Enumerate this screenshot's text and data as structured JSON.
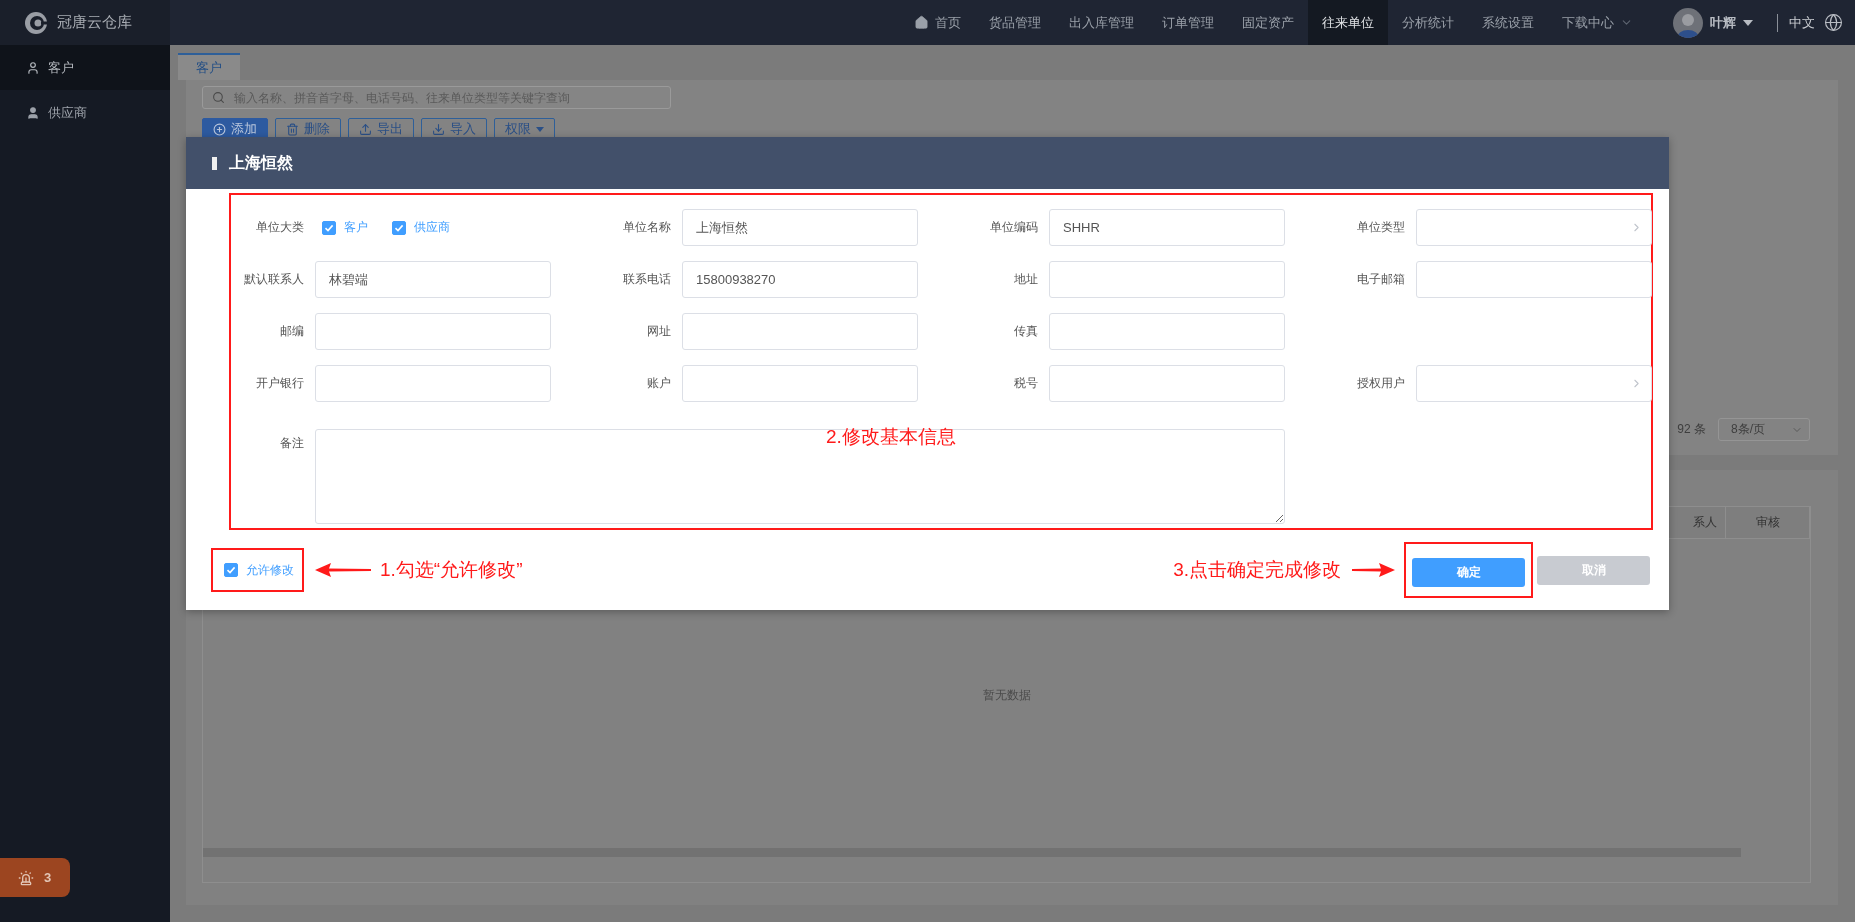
{
  "app": {
    "name": "冠唐云仓库"
  },
  "nav": [
    {
      "label": "首页",
      "has_icon": true,
      "has_menu": false,
      "selected": false
    },
    {
      "label": "货品管理",
      "has_icon": false,
      "has_menu": false,
      "selected": false
    },
    {
      "label": "出入库管理",
      "has_icon": false,
      "has_menu": false,
      "selected": false
    },
    {
      "label": "订单管理",
      "has_icon": false,
      "has_menu": false,
      "selected": false
    },
    {
      "label": "固定资产",
      "has_icon": false,
      "has_menu": false,
      "selected": false
    },
    {
      "label": "往来单位",
      "has_icon": false,
      "has_menu": false,
      "selected": true
    },
    {
      "label": "分析统计",
      "has_icon": false,
      "has_menu": false,
      "selected": false
    },
    {
      "label": "系统设置",
      "has_icon": false,
      "has_menu": false,
      "selected": false
    },
    {
      "label": "下载中心",
      "has_icon": false,
      "has_menu": true,
      "selected": false
    }
  ],
  "user": {
    "name": "叶辉"
  },
  "language": "中文",
  "sidebar": {
    "items": [
      {
        "label": "客户",
        "selected": true
      },
      {
        "label": "供应商",
        "selected": false
      }
    ]
  },
  "alarm": {
    "count": "3"
  },
  "tabs": [
    {
      "label": "客户",
      "selected": true
    }
  ],
  "search": {
    "placeholder": "输入名称、拼音首字母、电话号码、往来单位类型等关键字查询"
  },
  "toolbar": [
    {
      "label": "添加",
      "kind": "primary"
    },
    {
      "label": "删除",
      "kind": "default"
    },
    {
      "label": "导出",
      "kind": "default"
    },
    {
      "label": "导入",
      "kind": "default"
    },
    {
      "label": "权限",
      "kind": "dropdown"
    }
  ],
  "pagination": {
    "total": "92 条",
    "page_size": "8条/页"
  },
  "table": {
    "columns": [
      "系人",
      "审核"
    ],
    "empty_text": "暂无数据"
  },
  "dialog": {
    "title": "上海恒然",
    "form_note": "2.修改基本信息",
    "rows": [
      {
        "fields": [
          {
            "kind": "checks",
            "label": "单位大类",
            "options": [
              {
                "label": "客户",
                "checked": true
              },
              {
                "label": "供应商",
                "checked": true
              }
            ]
          },
          {
            "kind": "text",
            "label": "单位名称",
            "value": "上海恒然"
          },
          {
            "kind": "text",
            "label": "单位编码",
            "value": "SHHR"
          },
          {
            "kind": "select",
            "label": "单位类型"
          }
        ]
      },
      {
        "fields": [
          {
            "kind": "text",
            "label": "默认联系人",
            "value": "林碧端"
          },
          {
            "kind": "text",
            "label": "联系电话",
            "value": "15800938270"
          },
          {
            "kind": "text",
            "label": "地址"
          },
          {
            "kind": "text",
            "label": "电子邮箱"
          }
        ]
      },
      {
        "fields": [
          {
            "kind": "text",
            "label": "邮编"
          },
          {
            "kind": "text",
            "label": "网址"
          },
          {
            "kind": "text",
            "label": "传真"
          }
        ]
      },
      {
        "fields": [
          {
            "kind": "text",
            "label": "开户银行"
          },
          {
            "kind": "text",
            "label": "账户"
          },
          {
            "kind": "text",
            "label": "税号"
          },
          {
            "kind": "select",
            "label": "授权用户"
          }
        ]
      },
      {
        "fields": [
          {
            "kind": "textarea",
            "label": "备注"
          }
        ]
      }
    ],
    "allow_edit": {
      "label": "允许修改",
      "checked": true,
      "note": "1.勾选“允许修改”"
    },
    "confirm_note": "3.点击确定完成修改",
    "buttons": [
      {
        "label": "确定",
        "kind": "primary"
      },
      {
        "label": "取消",
        "kind": "secondary"
      }
    ]
  }
}
